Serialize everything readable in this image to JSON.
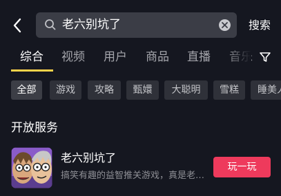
{
  "search": {
    "query": "老六别坑了",
    "submit_label": "搜索"
  },
  "tabs": [
    "综合",
    "视频",
    "用户",
    "商品",
    "直播",
    "音乐"
  ],
  "chips": [
    "全部",
    "游戏",
    "攻略",
    "甄嬛",
    "大聪明",
    "雪糕",
    "睡美人"
  ],
  "section": {
    "title": "开放服务"
  },
  "result": {
    "name": "老六别坑了",
    "description": "搞笑有趣的益智推关游戏，真是老六别坑了",
    "action_label": "玩一玩"
  },
  "colors": {
    "background": "#151720",
    "accent_underline": "#ffd44b",
    "play_button": "#ee3a5c"
  }
}
